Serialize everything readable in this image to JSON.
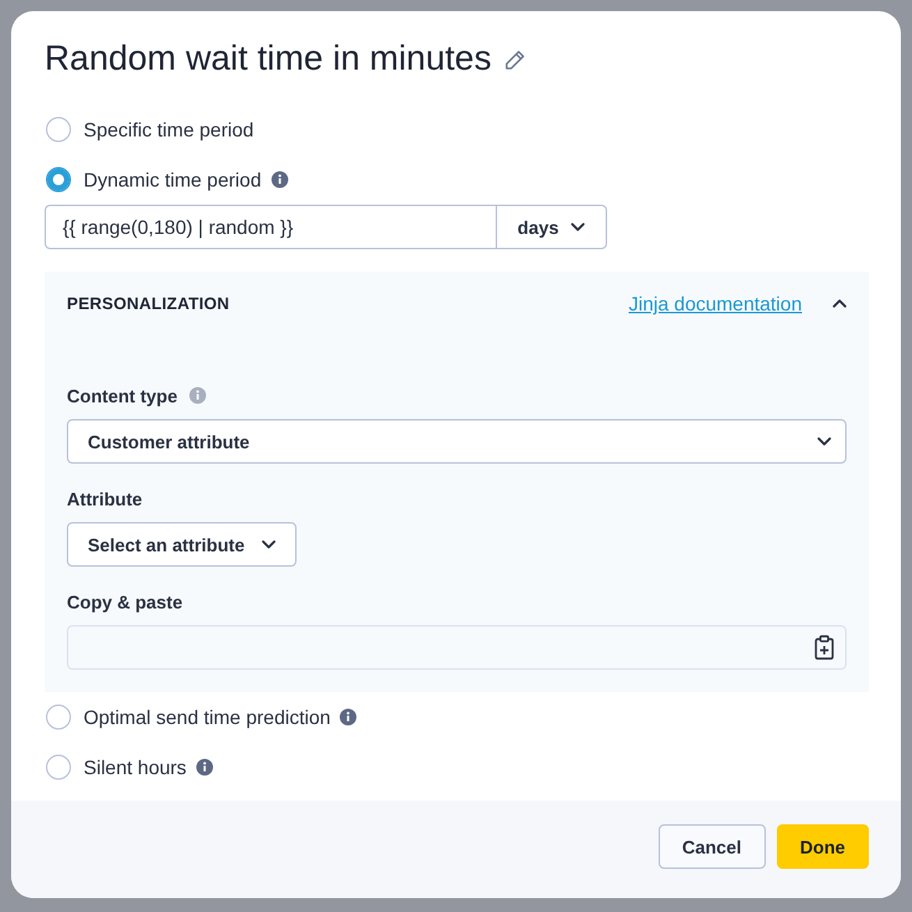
{
  "dialog": {
    "title": "Random wait time in minutes"
  },
  "options": [
    {
      "label": "Specific time period",
      "selected": false,
      "info": false
    },
    {
      "label": "Dynamic time period",
      "selected": true,
      "info": true,
      "expression": {
        "value": "{{ range(0,180) | random }}",
        "unit": "days"
      },
      "personalization": {
        "heading": "PERSONALIZATION",
        "link": "Jinja documentation",
        "expanded": true,
        "fields": [
          {
            "kind": "select",
            "label": "Content type",
            "info": true,
            "value": "Customer attribute"
          },
          {
            "kind": "dropdown",
            "label": "Attribute",
            "info": false,
            "value": "Select an attribute"
          },
          {
            "kind": "paste",
            "label": "Copy & paste",
            "info": false
          }
        ]
      }
    },
    {
      "label": "Optimal send time prediction",
      "selected": false,
      "info": true
    },
    {
      "label": "Silent hours",
      "selected": false,
      "info": true
    }
  ],
  "footer": {
    "buttons": [
      {
        "label": "Cancel",
        "kind": "secondary"
      },
      {
        "label": "Done",
        "kind": "primary"
      }
    ]
  }
}
